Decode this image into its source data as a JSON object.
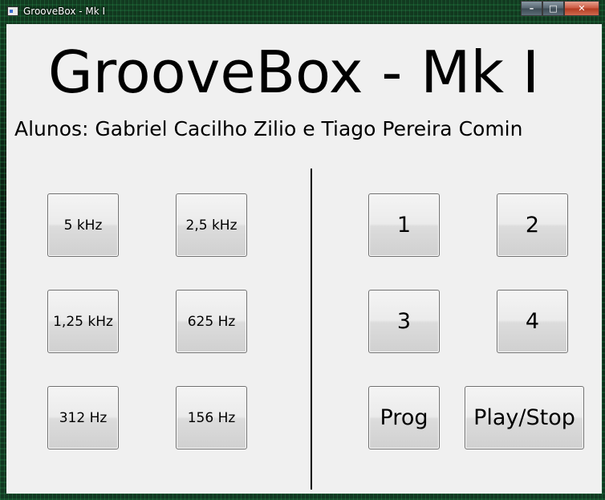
{
  "window": {
    "title": "GrooveBox - Mk I",
    "minimize_glyph": "–",
    "maximize_glyph": "□",
    "close_glyph": "✕"
  },
  "header": {
    "title": "GrooveBox - Mk I",
    "students": "Alunos: Gabriel Cacilho Zilio e Tiago Pereira Comin"
  },
  "frequency_buttons": [
    {
      "label": "5 kHz"
    },
    {
      "label": "2,5 kHz"
    },
    {
      "label": "1,25 kHz"
    },
    {
      "label": "625 Hz"
    },
    {
      "label": "312 Hz"
    },
    {
      "label": "156 Hz"
    }
  ],
  "pattern_buttons": [
    {
      "label": "1"
    },
    {
      "label": "2"
    },
    {
      "label": "3"
    },
    {
      "label": "4"
    }
  ],
  "controls": {
    "prog_label": "Prog",
    "play_stop_label": "Play/Stop"
  },
  "colors": {
    "client_bg": "#f0f0f0",
    "frame_accent": "#2fa85a"
  }
}
